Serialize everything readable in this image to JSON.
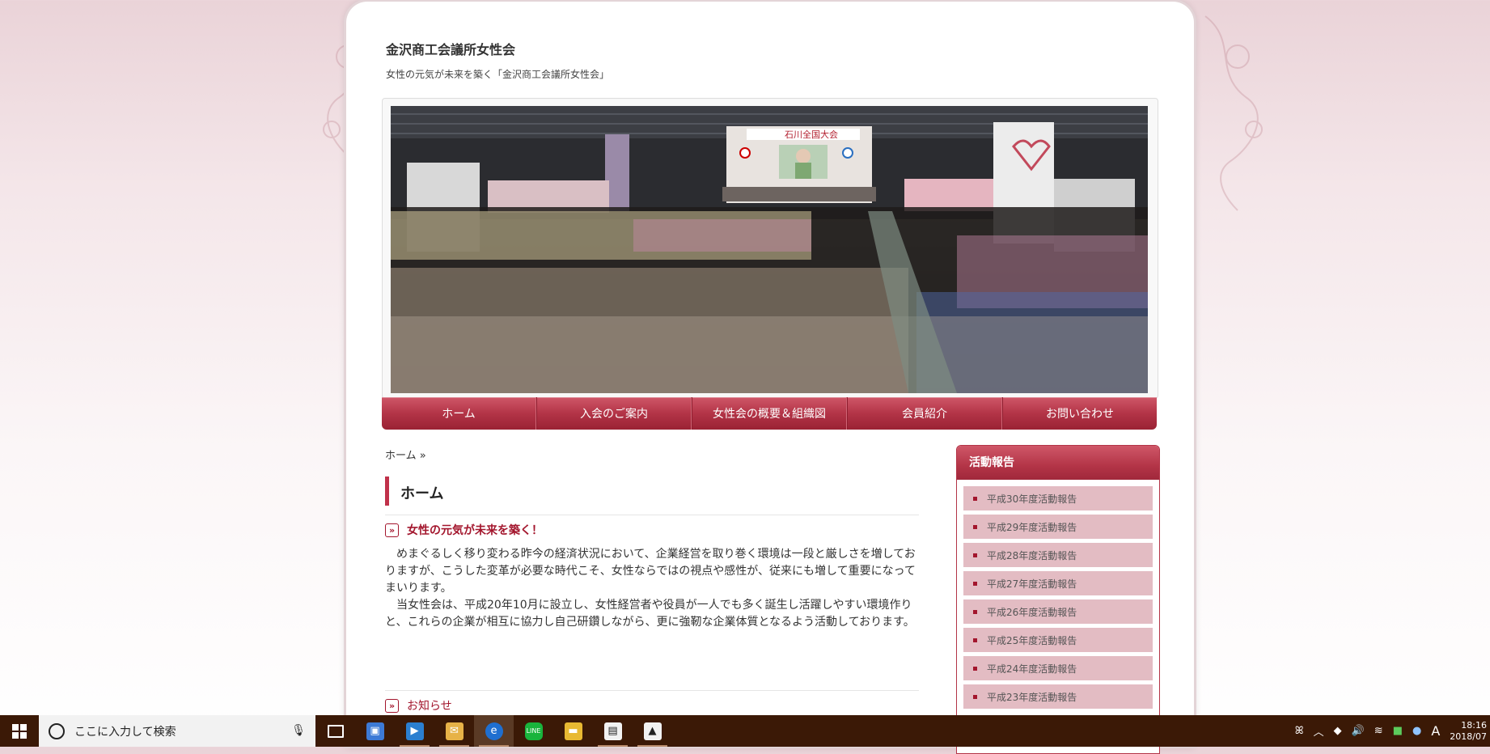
{
  "site": {
    "title": "金沢商工会議所女性会",
    "description": "女性の元気が未来を築く「金沢商工会議所女性会」"
  },
  "hero": {
    "banner_text": "石川全国大会"
  },
  "nav": {
    "items": [
      "ホーム",
      "入会のご案内",
      "女性会の概要＆組織図",
      "会員紹介",
      "お問い合わせ"
    ]
  },
  "breadcrumb": "ホーム »",
  "main": {
    "page_title": "ホーム",
    "section_title": "女性の元気が未来を築く！",
    "paragraphs": [
      "　めまぐるしく移り変わる昨今の経済状況において、企業経営を取り巻く環境は一段と厳しさを増しておりますが、こうした変革が必要な時代こそ、女性ならではの視点や感性が、従来にも増して重要になってまいります。",
      "　当女性会は、平成20年10月に設立し、女性経営者や役員が一人でも多く誕生し活躍しやすい環境作りと、これらの企業が相互に協力し自己研鑽しながら、更に強靭な企業体質となるよう活動しております。"
    ],
    "news_title": "お知らせ"
  },
  "sidebar": {
    "heading": "活動報告",
    "items": [
      "平成30年度活動報告",
      "平成29年度活動報告",
      "平成28年度活動報告",
      "平成27年度活動報告",
      "平成26年度活動報告",
      "平成25年度活動報告",
      "平成24年度活動報告",
      "平成23年度活動報告"
    ]
  },
  "taskbar": {
    "search_placeholder": "ここに入力して検索",
    "apps": [
      "task-view-icon",
      "store-icon",
      "media-player-icon",
      "mail-icon",
      "edge-icon",
      "line-icon",
      "file-explorer-icon",
      "movie-icon",
      "photos-icon"
    ],
    "clock_time": "18:16",
    "clock_date": "2018/07",
    "ime": "A"
  },
  "colors": {
    "accent": "#b33447",
    "accent_dark": "#a3162d",
    "taskbar": "#3b1906"
  }
}
